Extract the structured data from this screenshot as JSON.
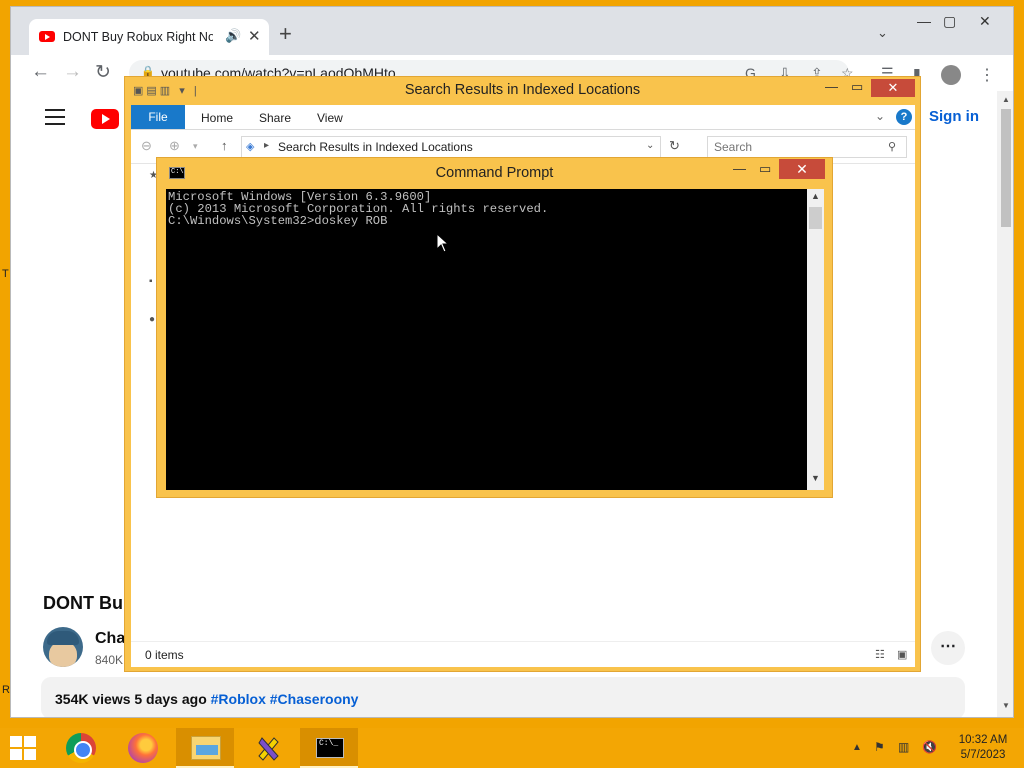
{
  "chrome": {
    "tab_title": "DONT Buy Robux Right Now",
    "url": "youtube.com/watch?v=pLaodQbMHto"
  },
  "youtube": {
    "sign_in": "Sign in",
    "video_title": "DONT Bu",
    "channel_name": "Cha",
    "subscribers": "840K",
    "views_date": "354K views  5 days ago ",
    "hashtags": "#Roblox #Chaseroony"
  },
  "explorer": {
    "title": "Search Results in Indexed Locations",
    "ribbon_tabs": [
      "File",
      "Home",
      "Share",
      "View"
    ],
    "address_path": "Search Results in Indexed Locations",
    "search_placeholder": "Search",
    "status_items": "0 items"
  },
  "cmd": {
    "title": "Command Prompt",
    "lines": [
      "Microsoft Windows [Version 6.3.9600]",
      "(c) 2013 Microsoft Corporation. All rights reserved.",
      "",
      "C:\\Windows\\System32>doskey ROB"
    ]
  },
  "taskbar": {
    "time": "10:32 AM",
    "date": "5/7/2023"
  },
  "desktop": {
    "edge_letters": [
      "T",
      "R"
    ]
  },
  "colors": {
    "desktop_bg": "#f2a400",
    "window_frame": "#f9c34c",
    "close_red": "#c74b3a",
    "youtube_red": "#ff0000",
    "link_blue": "#065fd4"
  }
}
